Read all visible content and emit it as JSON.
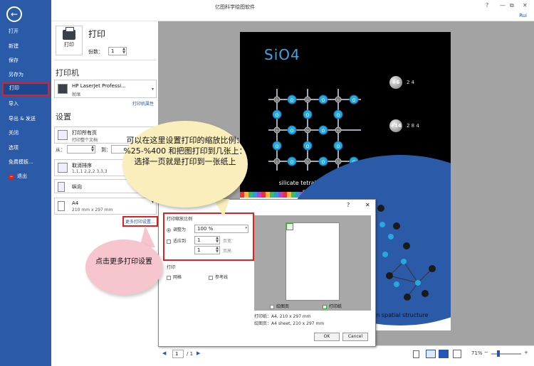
{
  "window": {
    "title": "亿图科学绘图软件",
    "controls": [
      "?",
      "—",
      "⧉",
      "✕"
    ],
    "user": "Rui"
  },
  "sidebar": {
    "items": [
      {
        "label": "打开"
      },
      {
        "label": "新建"
      },
      {
        "label": "保存"
      },
      {
        "label": "另存为"
      },
      {
        "label": "打印",
        "active": true
      },
      {
        "label": "导入"
      },
      {
        "label": "导出 & 发送"
      },
      {
        "label": "关闭"
      },
      {
        "label": "选项"
      },
      {
        "label": "免费模板..."
      },
      {
        "label": "退出"
      }
    ]
  },
  "print": {
    "title": "打印",
    "button_label": "打印",
    "copies_label": "份数：",
    "copies_value": "1",
    "printer_section": "打印机",
    "printer_name": "HP LaserJet Professi...",
    "printer_status": "就绪",
    "printer_props_link": "打印机属性",
    "settings_section": "设置",
    "range_title": "打印所有页",
    "range_sub": "打印整个文档",
    "from_label": "从：",
    "to_label": "到：",
    "collate_title": "取消排序",
    "collate_sub": "1,1,1   2,2,2   3,3,3",
    "orientation": "纵向",
    "paper_title": "A4",
    "paper_sub": "210 mm x 297 mm",
    "more_settings_link": "更多打印设置..."
  },
  "preview": {
    "title": "SiO4",
    "caption1": "silicate tetrahedron plane structure",
    "caption2": "rahedron spatial structure",
    "atom_labels": [
      "O",
      "Si"
    ],
    "atom1_charge": "+6",
    "atom1_shells": "2  4",
    "atom2_charge": "+14",
    "atom2_shells": "2  8  4"
  },
  "bottom": {
    "page_value": "1",
    "page_total": "/ 1",
    "zoom": "71%"
  },
  "dialog": {
    "help": "?",
    "close": "✕",
    "scale_group": "打印缩放比例",
    "fit_label": "调整为",
    "fit_value": "100 %",
    "fitto_label": "适应到",
    "pages_value1": "1",
    "pages_unit1": "页宽",
    "pages_value2": "1",
    "pages_unit2": "页高",
    "print_group": "打印",
    "grid_label": "网格",
    "guides_label": "参考线",
    "legend_drawing": "绘图页",
    "legend_print": "打印纸",
    "paper_info": "打印纸：A4, 210 x 297 mm",
    "drawing_info": "绘图页：A4 sheet, 210 x 297 mm",
    "ok": "OK",
    "cancel": "Cancel"
  },
  "callouts": {
    "tip1": "可以在这里设置打印的缩放比例：%25-%400 和把图打印到几张上：选择一页就是打印到一张纸上",
    "tip2": "点击更多打印设置"
  },
  "colors": {
    "sidebar": "#2b5aa8",
    "highlight": "#e02020",
    "callout1": "#faeebd",
    "callout2": "#f6c5cd"
  }
}
